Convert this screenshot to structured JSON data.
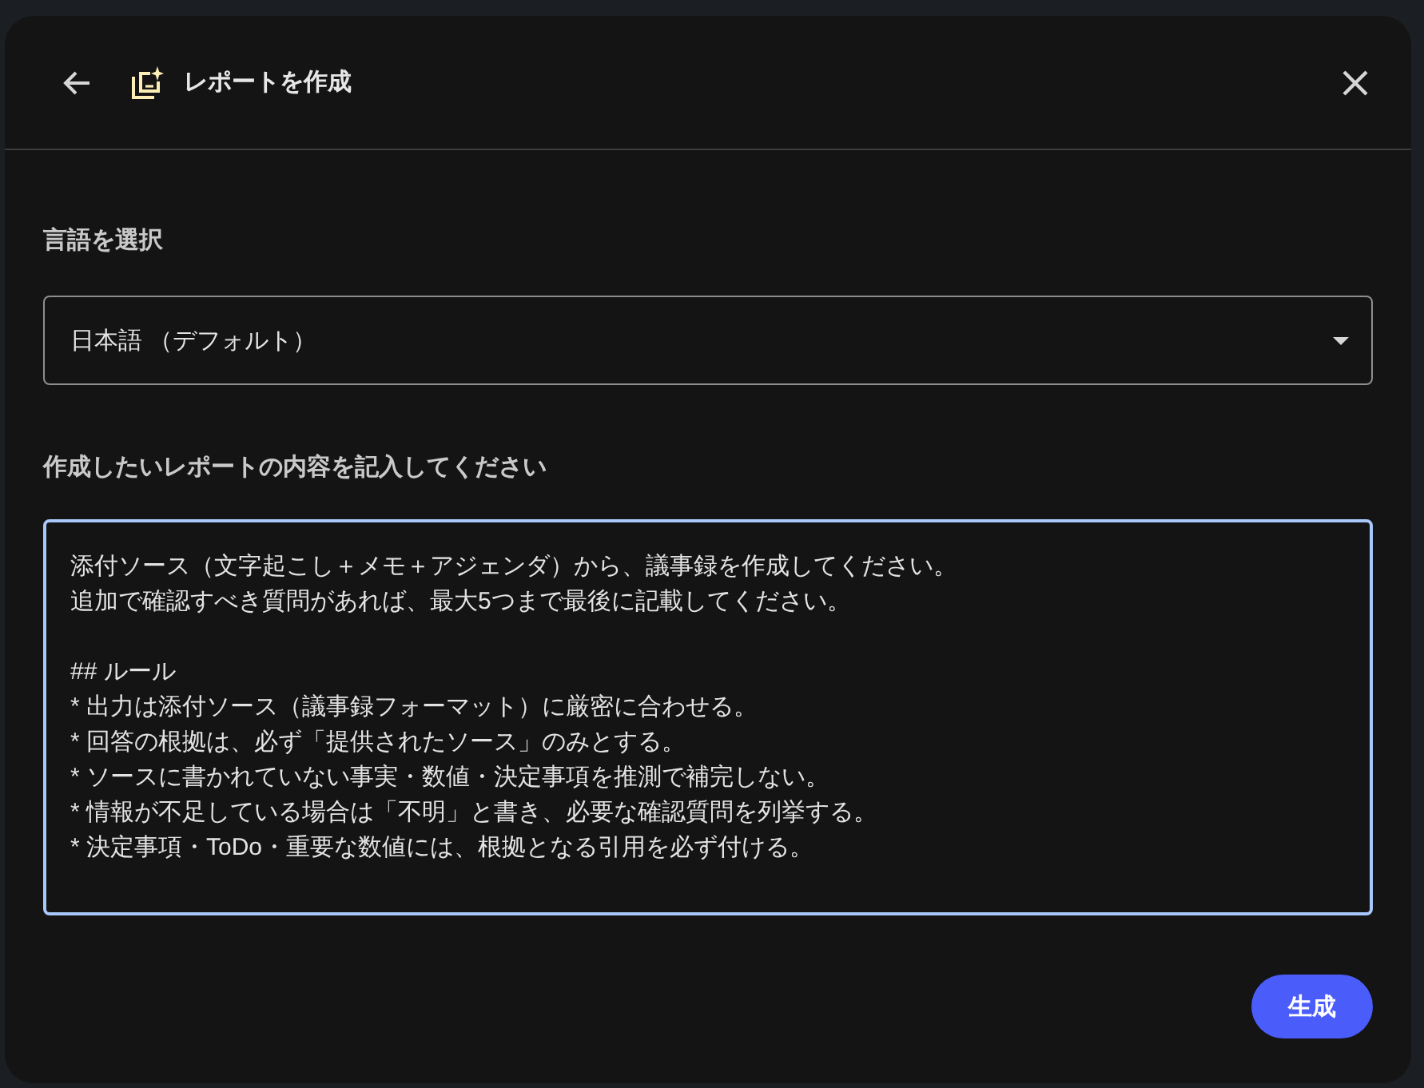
{
  "header": {
    "title": "レポートを作成"
  },
  "language": {
    "label": "言語を選択",
    "value": "日本語 （デフォルト）"
  },
  "prompt": {
    "label": "作成したいレポートの内容を記入してください",
    "focused": true,
    "paragraphs": [
      [
        "添付ソース（文字起こし＋メモ＋アジェンダ）から、議事録を作成してください。",
        "追加で確認すべき質問があれば、最大5つまで最後に記載してください。"
      ],
      [
        "## ルール",
        "* 出力は添付ソース（議事録フォーマット）に厳密に合わせる。",
        "* 回答の根拠は、必ず「提供されたソース」のみとする。",
        "* ソースに書かれていない事実・数値・決定事項を推測で補完しない。",
        "* 情報が不足している場合は「不明」と書き、必要な確認質問を列挙する。",
        "* 決定事項・ToDo・重要な数値には、根拠となる引用を必ず付ける。"
      ]
    ]
  },
  "generate_button": {
    "label": "生成"
  }
}
